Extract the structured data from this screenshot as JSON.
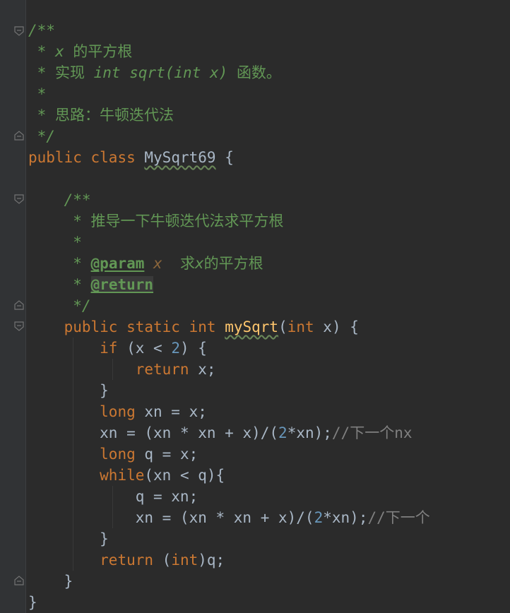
{
  "editor": {
    "class_doc": {
      "open": "/**",
      "line1_star": "*",
      "line1_x": "x",
      "line1_text": "的平方根",
      "line2_star": "*",
      "line2_prefix": "实现",
      "line2_sig": "int sqrt(int x)",
      "line2_suffix": "函数。",
      "line3_star": "*",
      "line4_star": "*",
      "line4_text": "思路：牛顿迭代法",
      "close": "*/"
    },
    "class_decl": {
      "kw_public": "public",
      "kw_class": "class",
      "name": "MySqrt69",
      "brace": "{"
    },
    "method_doc": {
      "open": "/**",
      "line1_star": "*",
      "line1_text": "推导一下牛顿迭代法求平方根",
      "line2_star": "*",
      "line3_star": "*",
      "param_tag": "@param",
      "param_name": "x",
      "param_desc_pre": "求",
      "param_desc_x": "x",
      "param_desc_post": "的平方根",
      "line4_star": "*",
      "return_tag": "@return",
      "close": "*/"
    },
    "method_decl": {
      "kw_public": "public",
      "kw_static": "static",
      "kw_int": "int",
      "name": "mySqrt",
      "paren_open": "(",
      "param_type": "int",
      "params_rest": " x) {"
    },
    "body": {
      "if_kw": "if",
      "if_cond_pre": " (x < ",
      "if_num": "2",
      "if_cond_post": ") {",
      "return1_kw": "return",
      "return1_rest": " x;",
      "close_if": "}",
      "long1_kw": "long",
      "long1_rest": " xn = x;",
      "assign1_pre": "xn = (xn * xn + x)/(",
      "assign1_num": "2",
      "assign1_post": "*xn);",
      "assign1_comment_slashes": "//",
      "assign1_comment_text": "下一个",
      "assign1_comment_tail": "nx",
      "long2_kw": "long",
      "long2_rest": " q = x;",
      "while_kw": "while",
      "while_rest": "(xn < q){",
      "q_assign": "q = xn;",
      "assign2_pre": "xn = (xn * xn + x)/(",
      "assign2_num": "2",
      "assign2_post": "*xn);",
      "assign2_comment_slashes": "//",
      "assign2_comment_text": "下一个",
      "close_while": "}",
      "return2_kw": "return",
      "return2_paren": " (",
      "return2_type": "int",
      "return2_rest": ")q;",
      "close_method": "}",
      "close_class": "}"
    }
  }
}
